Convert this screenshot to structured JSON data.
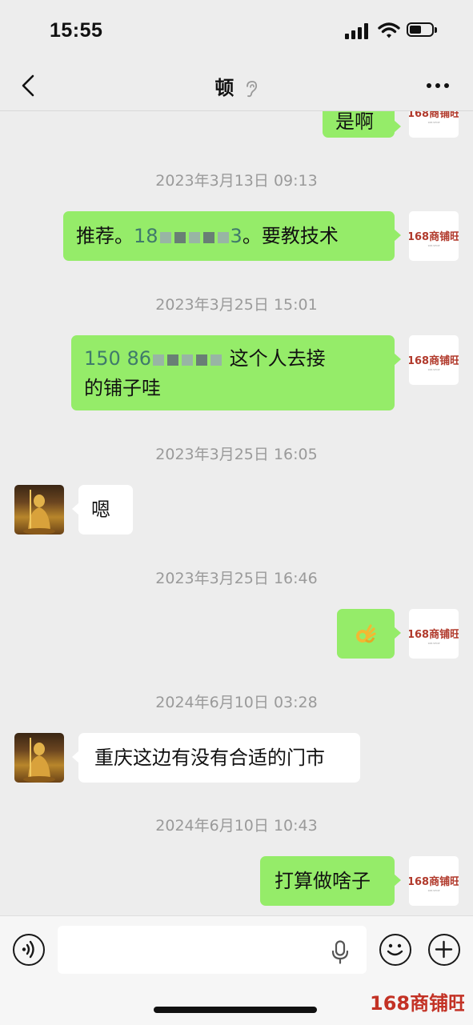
{
  "status_bar": {
    "time": "15:55"
  },
  "header": {
    "title": "顿"
  },
  "messages": [
    {
      "type": "me",
      "text": "是啊"
    },
    {
      "type": "timestamp",
      "text": "2023年3月13日 09:13"
    },
    {
      "type": "me",
      "prefix": "推荐。",
      "phone_start": "18",
      "phone_end": "3",
      "suffix": "。要教技术"
    },
    {
      "type": "timestamp",
      "text": "2023年3月25日 15:01"
    },
    {
      "type": "me",
      "phone_start": "150 86",
      "suffix": "这个人去接",
      "line2": "的铺子哇"
    },
    {
      "type": "timestamp",
      "text": "2023年3月25日 16:05"
    },
    {
      "type": "other",
      "text": "嗯"
    },
    {
      "type": "timestamp",
      "text": "2023年3月25日 16:46"
    },
    {
      "type": "me",
      "emoji": "ok-hand"
    },
    {
      "type": "timestamp",
      "text": "2024年6月10日 03:28"
    },
    {
      "type": "other",
      "text": "重庆这边有没有合适的门市"
    },
    {
      "type": "timestamp",
      "text": "2024年6月10日 10:43"
    },
    {
      "type": "me",
      "text": "打算做啥子"
    }
  ],
  "logo_avatar_text": "168商铺旺",
  "watermark": "168商铺旺",
  "colors": {
    "my_bubble": "#95ec69",
    "other_bubble": "#ffffff",
    "background": "#ededed",
    "brand": "#c33225"
  }
}
